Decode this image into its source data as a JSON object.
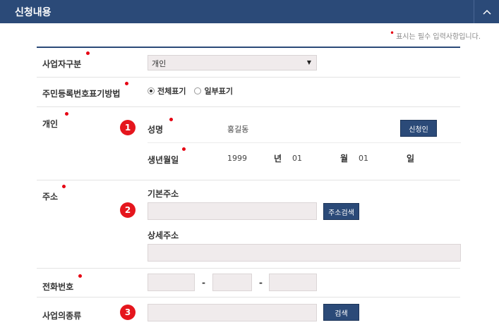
{
  "header": {
    "title": "신청내용",
    "toggle_icon": "^"
  },
  "required_note": "표시는 필수 입력사항입니다.",
  "colors": {
    "header_bg": "#2b4a78",
    "required_dot": "#e60012",
    "badge": "#e5161d",
    "input_bg": "#f0ebec"
  },
  "business_type": {
    "label": "사업자구분",
    "selected": "개인"
  },
  "id_display": {
    "label": "주민등록번호표기방법",
    "options": [
      {
        "label": "전체표기",
        "checked": true
      },
      {
        "label": "일부표기",
        "checked": false
      }
    ]
  },
  "individual": {
    "label": "개인",
    "badge": "1",
    "name_label": "성명",
    "name_value": "홍길동",
    "applicant_button": "신청인",
    "birth_label": "생년월일",
    "year": "1999",
    "year_unit": "년",
    "month": "01",
    "month_unit": "월",
    "day": "01",
    "day_unit": "일"
  },
  "address": {
    "label": "주소",
    "badge": "2",
    "basic_label": "기본주소",
    "search_button": "주소검색",
    "detail_label": "상세주소"
  },
  "phone": {
    "label": "전화번호",
    "dash": "-"
  },
  "business_category": {
    "label": "사업의종류",
    "badge": "3",
    "search_button": "검색"
  }
}
